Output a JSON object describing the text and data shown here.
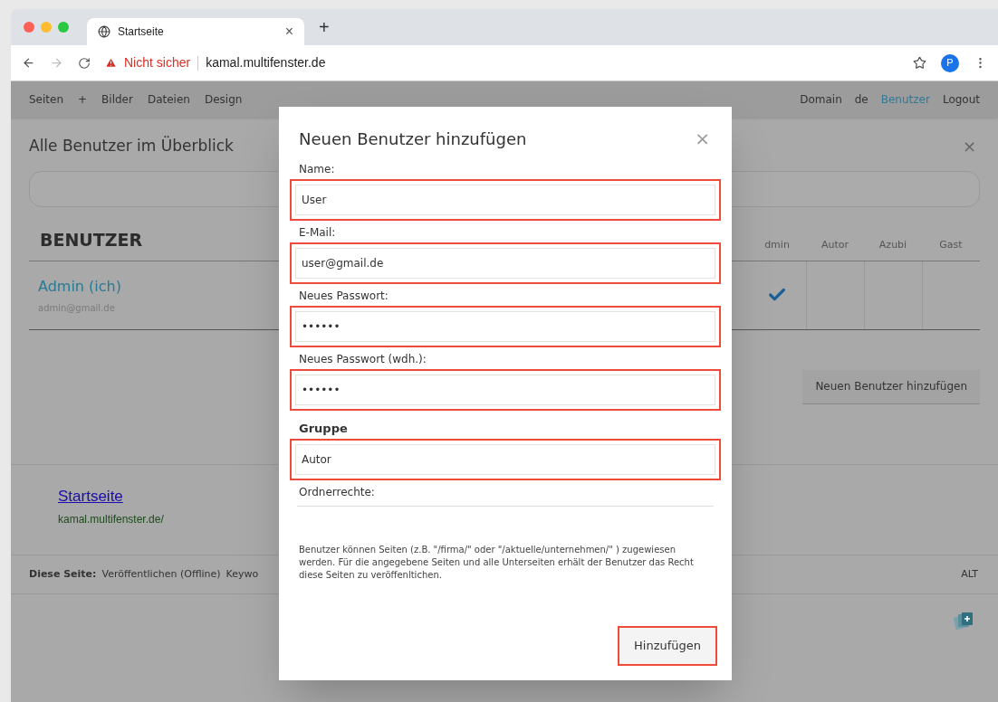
{
  "browser": {
    "tabs": [
      {
        "title": "Startseite",
        "close": "×",
        "selected": true
      }
    ],
    "new_tab": "+",
    "nav": {
      "forward_disabled": true
    },
    "security": "Nicht sicher",
    "url": "kamal.multifenster.de",
    "profile": "P"
  },
  "menu": {
    "left": [
      {
        "label": "Seiten",
        "selected": false
      },
      {
        "label": "+",
        "selected": false
      },
      {
        "label": "Bilder",
        "selected": false
      },
      {
        "label": "Dateien",
        "selected": false
      },
      {
        "label": "Design",
        "selected": false
      }
    ],
    "right": [
      {
        "label": "Domain",
        "selected": false
      },
      {
        "label": "de",
        "selected": false
      },
      {
        "label": "Benutzer",
        "selected": true
      },
      {
        "label": "Logout",
        "selected": false
      }
    ]
  },
  "panel": {
    "title": "Alle Benutzer im Überblick",
    "close": "×"
  },
  "users_table": {
    "heading": "BENUTZER",
    "columns": [
      "dmin",
      "Autor",
      "Azubi",
      "Gast"
    ],
    "rows": [
      {
        "name": "Admin (ich)",
        "email": "admin@gmail.de",
        "roles": [
          true,
          false,
          false,
          false
        ]
      }
    ],
    "add_button": "Neuen Benutzer hinzufügen"
  },
  "preview": {
    "title": "Startseite",
    "url": "kamal.multifenster.de/"
  },
  "page_bar": {
    "label": "Diese Seite:",
    "items": [
      "Veröffentlichen (Offline)",
      "Keywo"
    ],
    "right": "ALT"
  },
  "dialog": {
    "title": "Neuen Benutzer hinzufügen",
    "close": "×",
    "fields": [
      {
        "label": "Name:",
        "value": "User",
        "bold": false,
        "highlighted": true
      },
      {
        "label": "E-Mail:",
        "value": "user@gmail.de",
        "bold": false,
        "highlighted": true
      },
      {
        "label": "Neues Passwort:",
        "value": "••••••",
        "bold": false,
        "highlighted": true
      },
      {
        "label": "Neues Passwort (wdh.):",
        "value": "••••••",
        "bold": false,
        "highlighted": true
      },
      {
        "label": "Gruppe",
        "value": "Autor",
        "bold": true,
        "highlighted": true
      },
      {
        "label": "Ordnerrechte:",
        "bold": false,
        "highlighted": false
      }
    ],
    "help": "Benutzer können Seiten (z.B. \"/firma/\" oder \"/aktuelle/unternehmen/\" ) zugewiesen werden. Für die angegebene Seiten und alle Unterseiten erhält der Benutzer das Recht diese Seiten zu veröffenltichen.",
    "submit": {
      "label": "Hinzufügen",
      "highlighted": true
    }
  }
}
